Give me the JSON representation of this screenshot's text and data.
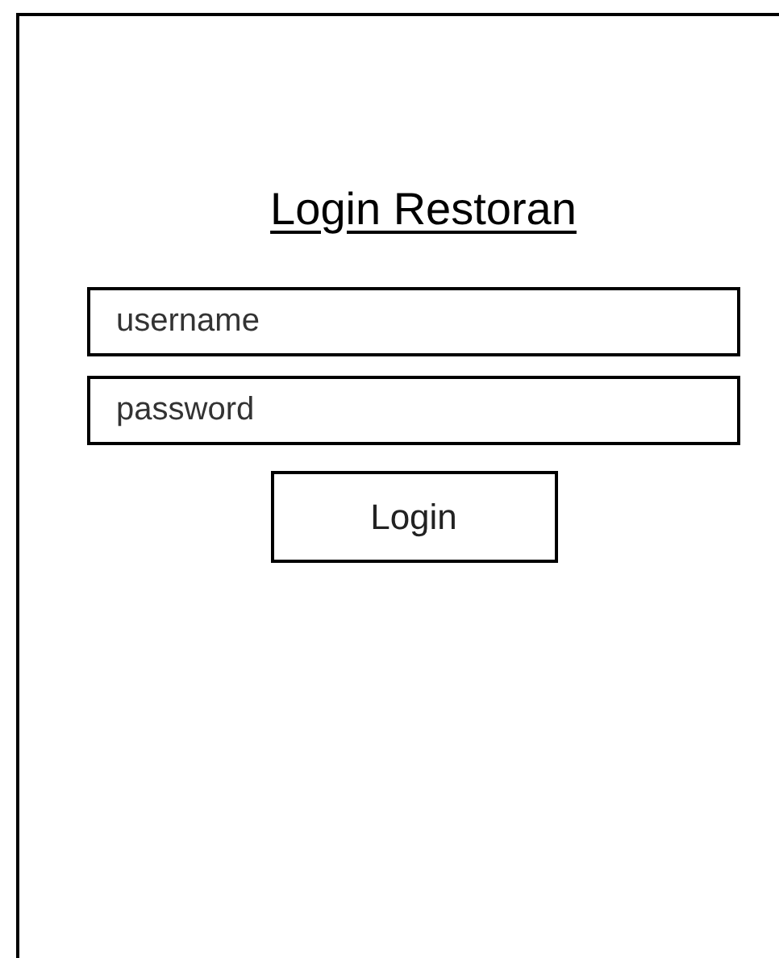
{
  "title": "Login Restoran",
  "fields": [
    {
      "placeholder": "username"
    },
    {
      "placeholder": "password"
    }
  ],
  "button": {
    "label": "Login"
  }
}
